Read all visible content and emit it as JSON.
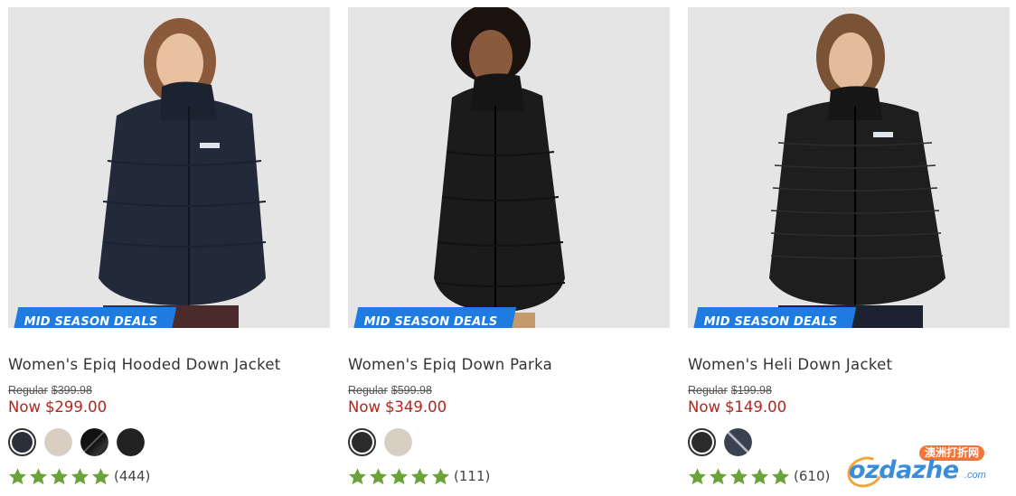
{
  "products": [
    {
      "badge": "MID SEASON DEALS",
      "title": "Women's Epiq Hooded Down Jacket",
      "regular_label": "Regular",
      "regular_price": "$399.98",
      "now_label": "Now",
      "now_price": "$299.00",
      "swatches": [
        "#2a2f3a",
        "#d8cfc2",
        "#1c1c1c",
        "#222222"
      ],
      "rating_stars": 5,
      "review_count": "(444)"
    },
    {
      "badge": "MID SEASON DEALS",
      "title": "Women's Epiq Down Parka",
      "regular_label": "Regular",
      "regular_price": "$599.98",
      "now_label": "Now",
      "now_price": "$349.00",
      "swatches": [
        "#2b2b2b",
        "#d8cfc2"
      ],
      "rating_stars": 5,
      "review_count": "(111)"
    },
    {
      "badge": "MID SEASON DEALS",
      "title": "Women's Heli Down Jacket",
      "regular_label": "Regular",
      "regular_price": "$199.98",
      "now_label": "Now",
      "now_price": "$149.00",
      "swatches": [
        "#2b2b2b",
        "#3a4150"
      ],
      "rating_stars": 5,
      "review_count": "(610)"
    }
  ],
  "watermark": {
    "cn_text": "澳洲打折网",
    "logo_text": "ozdazhe",
    "domain": ".com"
  },
  "colors": {
    "badge_blue": "#1e7ce0",
    "sale_red": "#b3261e",
    "star_green": "#6aa33a"
  }
}
